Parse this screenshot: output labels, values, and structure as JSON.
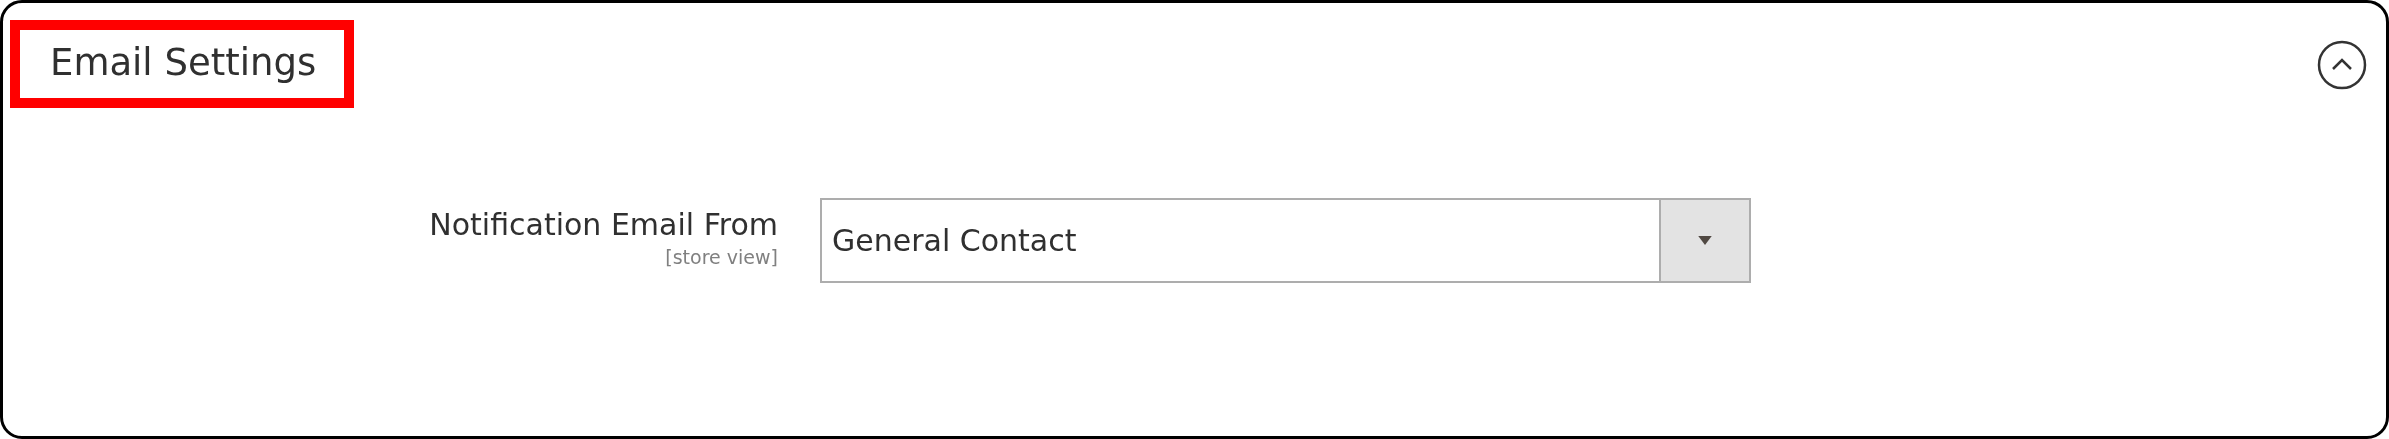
{
  "section": {
    "title": "Email Settings",
    "highlighted": true,
    "expanded": true
  },
  "fields": [
    {
      "label": "Notification Email From",
      "scope": "[store view]",
      "kind": "select",
      "value": "General Contact"
    }
  ]
}
